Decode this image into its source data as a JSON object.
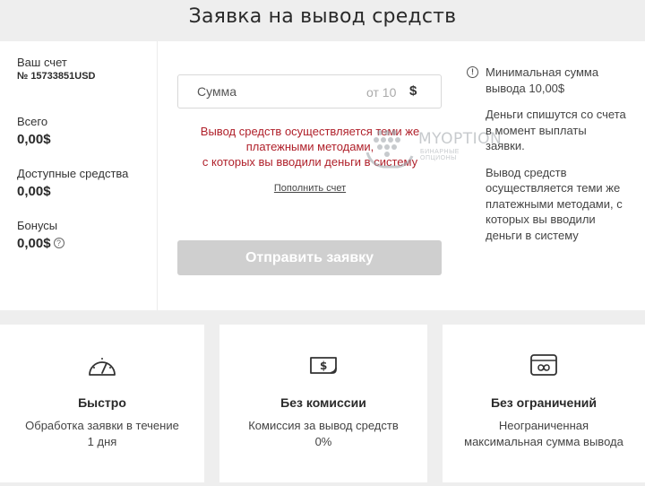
{
  "page": {
    "title": "Заявка на вывод средств"
  },
  "sidebar": {
    "account_label": "Ваш счет",
    "account_number": "№ 15733851USD",
    "total_label": "Всего",
    "total_value": "0,00$",
    "available_label": "Доступные средства",
    "available_value": "0,00$",
    "bonus_label": "Бонусы",
    "bonus_value": "0,00$",
    "help_glyph": "?"
  },
  "form": {
    "amount_placeholder": "Сумма",
    "amount_value": "",
    "amount_min": "от 10",
    "currency_symbol": "$",
    "warning_line1": "Вывод средств осуществляется теми же",
    "warning_line2": "платежными методами,",
    "warning_line3": "с которых вы вводили деньги в систему",
    "topup_link": "Пополнить счет",
    "submit_label": "Отправить заявку"
  },
  "watermark": {
    "brand": "MYOPTION",
    "sub": "БИНАРНЫЕ ОПЦИОНЫ"
  },
  "info": {
    "icon_glyph": "!",
    "min_amount": "Минимальная сумма вывода 10,00$",
    "debit_note": "Деньги спишутся со счета в момент выплаты заявки.",
    "method_note": "Вывод средств осуществляется теми же платежными методами, с которых вы вводили деньги в систему"
  },
  "features": [
    {
      "icon": "speedometer-icon",
      "title": "Быстро",
      "desc": "Обработка заявки в течение 1 дня"
    },
    {
      "icon": "money-card-icon",
      "title": "Без комиссии",
      "desc": "Комиссия за вывод средств 0%"
    },
    {
      "icon": "infinity-card-icon",
      "title": "Без ограничений",
      "desc": "Неограниченная максимальная сумма вывода"
    }
  ],
  "colors": {
    "accent_warning": "#b0212b",
    "button_disabled": "#cfcfcf",
    "background": "#eeeeee"
  }
}
